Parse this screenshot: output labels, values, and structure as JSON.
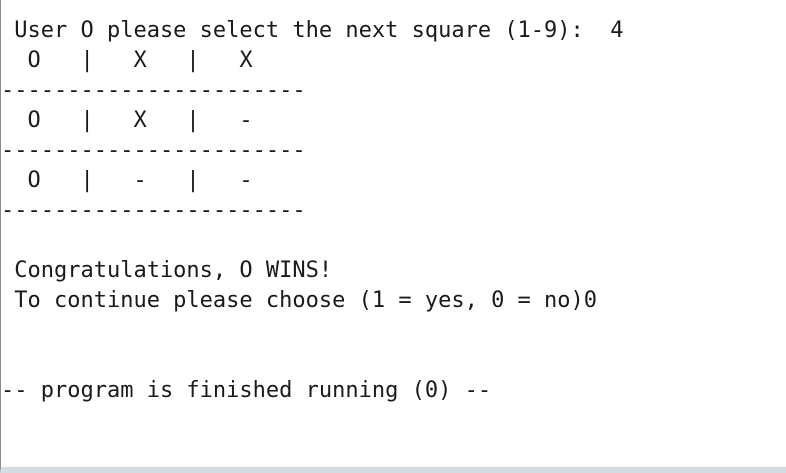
{
  "console": {
    "lines": [
      " User O please select the next square (1-9):  4",
      "  O   |   X   |   X",
      "-----------------------",
      "  O   |   X   |   -",
      "-----------------------",
      "  O   |   -   |   -",
      "-----------------------",
      "",
      " Congratulations, O WINS!",
      " To continue please choose (1 = yes, 0 = no)0",
      "",
      "",
      "-- program is finished running (0) --"
    ]
  }
}
